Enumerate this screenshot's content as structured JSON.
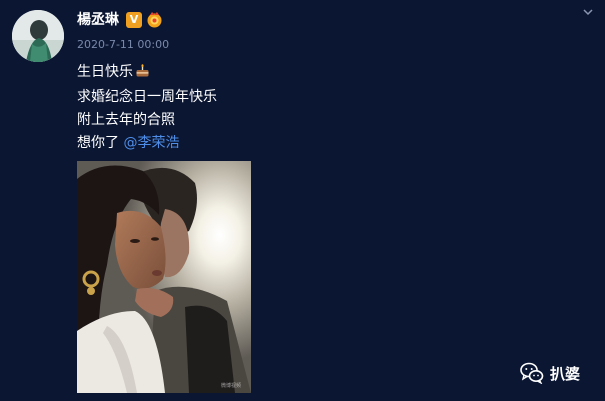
{
  "post": {
    "username": "楊丞琳",
    "vip_badge": "V",
    "timestamp": "2020-7-11 00:00",
    "lines": {
      "line1": "生日快乐",
      "line2": "求婚纪念日一周年快乐",
      "line3": "附上去年的合照",
      "line4_prefix": "想你了 ",
      "mention": "@李荣浩"
    },
    "photo_watermark": "微博视频"
  },
  "icons": {
    "line1_suffix": "cake-icon",
    "badge": "vip-badge-icon",
    "medal": "medal-icon",
    "menu": "chevron-down-icon",
    "brand": "wechat-icon"
  },
  "brand": {
    "label": "扒婆"
  },
  "colors": {
    "background": "#0b1633",
    "mention": "#4e8ee8",
    "timestamp": "#7a89aa",
    "vip": "#f0a020"
  }
}
